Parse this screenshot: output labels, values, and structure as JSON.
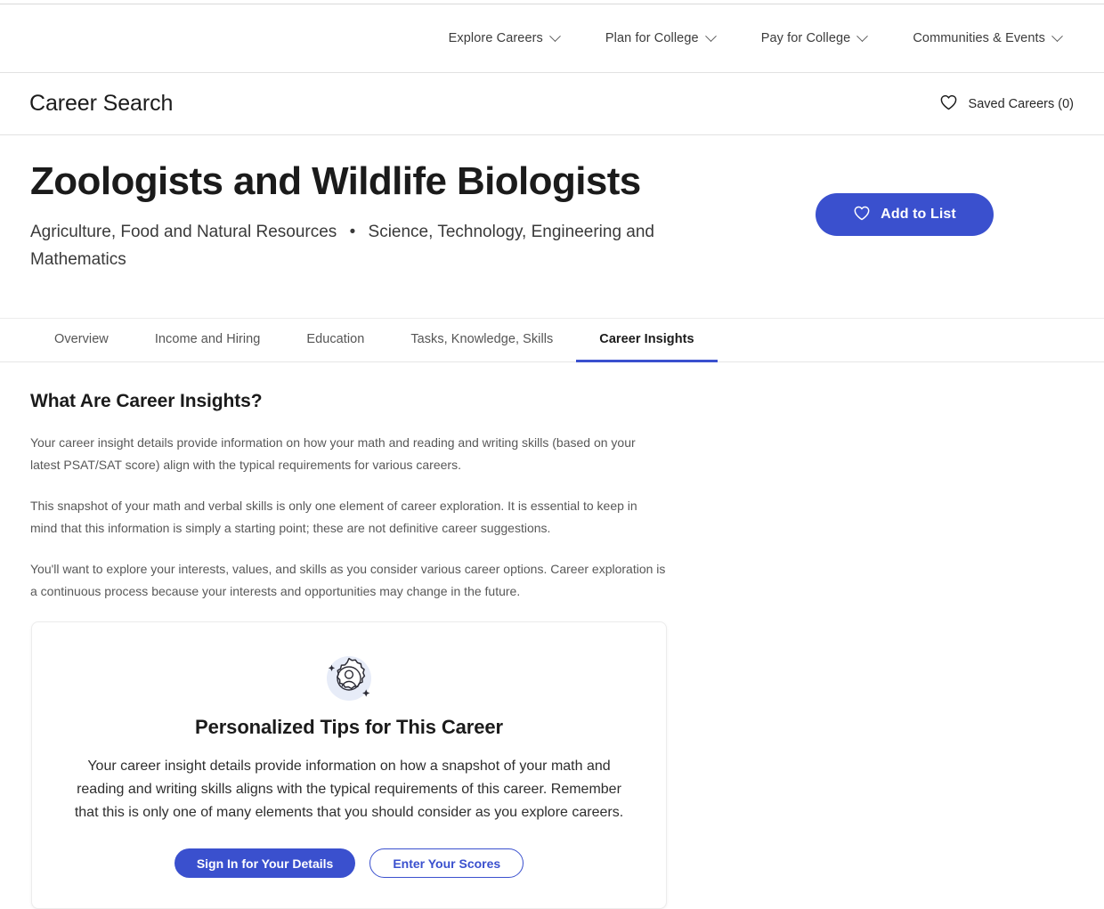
{
  "theme": {
    "accent": "#3a50ce",
    "text_primary": "#1b1b1b",
    "text_muted": "#585858",
    "border": "#e6e6e6"
  },
  "global_nav": {
    "items": [
      {
        "label": "Explore Careers",
        "icon": "chevron-down-icon"
      },
      {
        "label": "Plan for College",
        "icon": "chevron-down-icon"
      },
      {
        "label": "Pay for College",
        "icon": "chevron-down-icon"
      },
      {
        "label": "Communities & Events",
        "icon": "chevron-down-icon"
      }
    ]
  },
  "sub_header": {
    "brand_title": "Career Search",
    "saved_careers_label": "Saved Careers (0)",
    "saved_careers_icon": "heart-outline-icon"
  },
  "hero": {
    "career_title": "Zoologists and Wildlife Biologists",
    "clusters": [
      "Agriculture, Food and Natural Resources",
      "Science, Technology, Engineering and Mathematics"
    ],
    "cluster_separator": "•",
    "add_to_list_label": "Add to List",
    "add_to_list_icon": "heart-outline-icon"
  },
  "tabs": [
    {
      "label": "Overview",
      "active": false
    },
    {
      "label": "Income and Hiring",
      "active": false
    },
    {
      "label": "Education",
      "active": false
    },
    {
      "label": "Tasks, Knowledge, Skills",
      "active": false
    },
    {
      "label": "Career Insights",
      "active": true
    }
  ],
  "main": {
    "section_heading": "What Are Career Insights?",
    "paragraphs": [
      "Your career insight details provide information on how your math and reading and writing skills (based on your latest PSAT/SAT score) align with the typical requirements for various careers.",
      "This snapshot of your math and verbal skills is only one element of career exploration. It is essential to keep in mind that this information is simply a starting point; these are not definitive career suggestions.",
      "You'll want to explore your interests, values, and skills as you consider various career options. Career exploration is a continuous process because your interests and opportunities may change in the future."
    ]
  },
  "tips_card": {
    "badge_icon": "personalized-badge-icon",
    "heading": "Personalized Tips for This Career",
    "body": "Your career insight details provide information on how a snapshot of your math and reading and writing skills aligns with the typical requirements of this career. Remember that this is only one of many elements that you should consider as you explore careers.",
    "sign_in_label": "Sign In for Your Details",
    "enter_scores_label": "Enter Your Scores"
  }
}
